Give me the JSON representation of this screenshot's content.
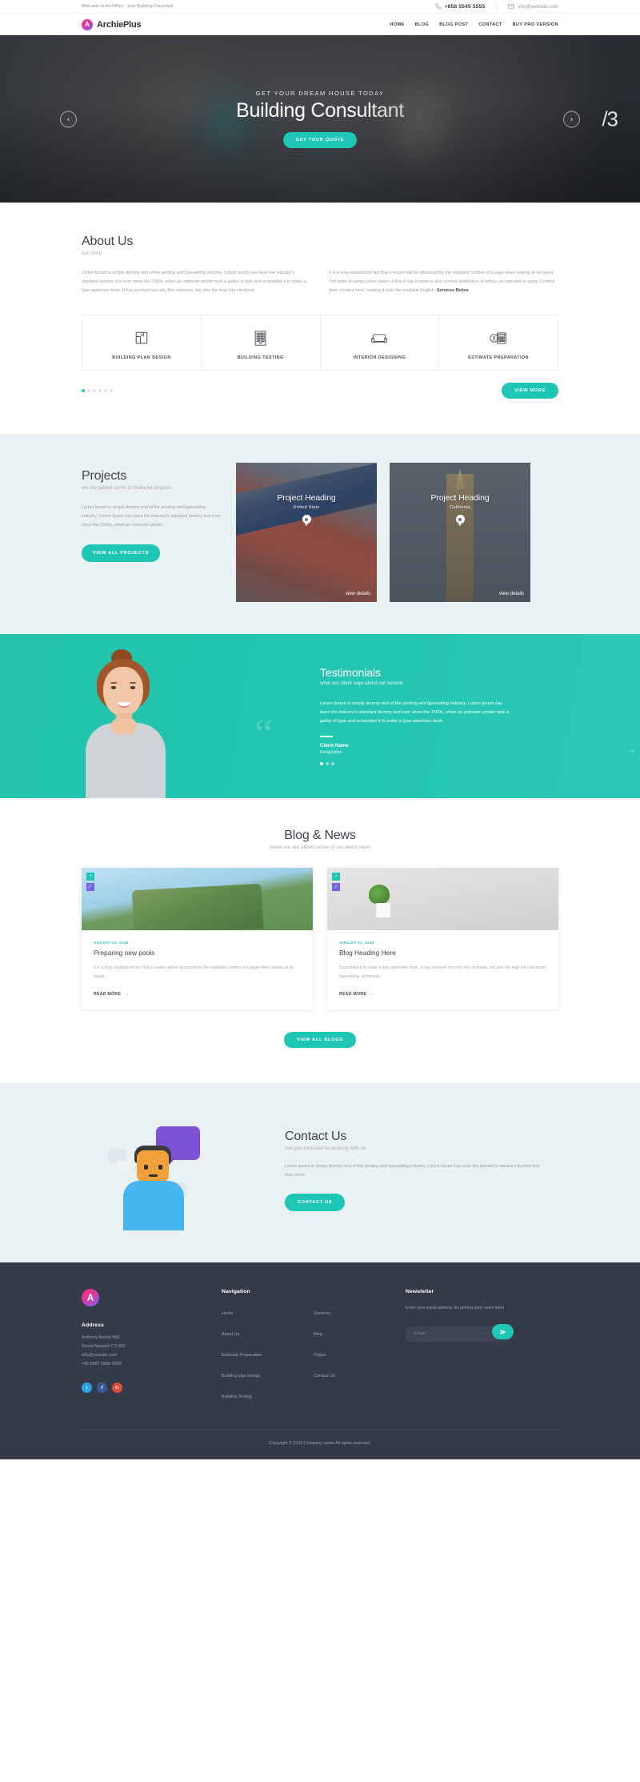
{
  "topbar": {
    "welcome": "Welcome to ArchiPlus - your Building Consulant",
    "phone_icon": "phone-icon",
    "phone": "+856 5545 5555",
    "mail_icon": "envelope-icon",
    "email": "info@website.com"
  },
  "nav": {
    "logo_letter": "A",
    "brand": "ArchiePlus",
    "items": [
      {
        "label": "HOME"
      },
      {
        "label": "BLOG"
      },
      {
        "label": "BLOG POST"
      },
      {
        "label": "CONTACT"
      },
      {
        "label": "BUY PRO VERSION"
      }
    ]
  },
  "hero": {
    "kicker": "GET YOUR DREAM HOUSE TODAY",
    "title": "Building Consultant",
    "cta": "GET YOUR QUOTE",
    "prev_icon": "chevron-left-icon",
    "next_icon": "chevron-right-icon",
    "prev_glyph": "‹",
    "next_glyph": "›",
    "slide_counter": "/3"
  },
  "about": {
    "title": "About Us",
    "subtitle": "our story",
    "left_text": "Lorem Ipsum is simply dummy text of the printing and typesetting industry. Lorem Ipsum has been the industry's standard dummy text ever since the 1500s, when an unknown printer took a galley of type and scrambled it to make a type specimen book. It has survived not only five centuries, but also the leap into electronic",
    "right_text": "It is a long established fact that a reader will be distracted by the readable content of a page when looking at its layout. The point of using Lorem Ipsum is that it has a more-or-less normal distribution of letters, as opposed to using 'Content here, content here', making it look like readable English. ",
    "right_text_bold": "Services Below",
    "services": [
      {
        "label": "BUILDING PLAN DESIGN",
        "icon": "floorplan-icon"
      },
      {
        "label": "BUILDING TESTING",
        "icon": "building-icon"
      },
      {
        "label": "INTERIOR DESIGNING",
        "icon": "sofa-icon"
      },
      {
        "label": "ESTIMATE PREPARATION",
        "icon": "calculator-money-icon"
      }
    ],
    "dots_total": 6,
    "dots_active": 1,
    "view_more": "VIEW MORE"
  },
  "projects": {
    "title": "Projects",
    "subtitle": "we are added some of featured projects",
    "text": "Lorem Ipsum is simply dummy text of the printing and typesetting industry. Lorem Ipsum has been the industry's standard dummy text ever since the 1500s, when an unknown printer...",
    "cta": "VIEW ALL PROJECTS",
    "cards": [
      {
        "heading": "Project Heading",
        "place": "United State",
        "view": "view details",
        "pin_icon": "map-pin-icon"
      },
      {
        "heading": "Project Heading",
        "place": "California",
        "view": "view details",
        "pin_icon": "map-pin-icon"
      }
    ]
  },
  "testimonials": {
    "title": "Testimonials",
    "subtitle": "what our client says about out service",
    "quote_icon": "quote-mark-icon",
    "text": "Lorem Ipsum is simply dummy text of the printing and typesetting industry. Lorem Ipsum has been the industry's standard dummy text ever since the 1500s, when an unknown printer took a galley of type and scrambled it to make a type specimen book.",
    "client_name": "Client Name",
    "designation": "Designation",
    "dots_total": 3,
    "dots_active": 1,
    "end_quote": "”"
  },
  "blog": {
    "title": "Blog & News",
    "subtitle": "below we are added some of our latest news",
    "view_all": "VIEW ALL BLOGS",
    "posts": [
      {
        "date": "AUGUST 22, 2018",
        "heading": "Preparing new pools",
        "excerpt": "It is a long established fact that a reader will be distracted by the readable content of a page when looking at its layout...",
        "read_more": "READ MORE",
        "arrow": "→",
        "action_top_icon": "share-icon",
        "action_bottom_icon": "link-icon"
      },
      {
        "date": "AUGUST 22, 2018",
        "heading": "Blog Heading Here",
        "excerpt": "Scrambled it to make a type specimen book. It has survived not only five centuries, but also the leap into electronic typesetting, remaining...",
        "read_more": "READ MORE",
        "arrow": "→",
        "action_top_icon": "share-icon",
        "action_bottom_icon": "link-icon"
      }
    ]
  },
  "contact": {
    "title": "Contact Us",
    "subtitle": "Are you intrested to working with us",
    "text": "Lorem Ipsum is simply dummy text of the printing and typesetting industry. Lorem Ipsum has been the industry's standard dummy text ever since.",
    "cta": "CONTACT US",
    "illustration_icon": "person-chat-illustration"
  },
  "footer": {
    "logo_letter": "A",
    "address_title": "Address",
    "address_lines": [
      "Anthony Benoit 490,",
      "Street Norwich CT 063",
      "info@website.com",
      "+66 8887 6899 0009"
    ],
    "social": [
      {
        "name": "twitter-icon",
        "glyph": "t"
      },
      {
        "name": "facebook-icon",
        "glyph": "f"
      },
      {
        "name": "google-plus-icon",
        "glyph": "G"
      }
    ],
    "nav_title": "Navigation",
    "nav_col1": [
      {
        "label": "Home"
      },
      {
        "label": "About Us"
      },
      {
        "label": "Estimate Preparation"
      },
      {
        "label": "Building plan design"
      },
      {
        "label": "Building Testing"
      }
    ],
    "nav_col2": [
      {
        "label": "Services"
      },
      {
        "label": "Blog"
      },
      {
        "label": "Pages"
      },
      {
        "label": "Contact Us"
      }
    ],
    "newsletter_title": "Newsletter",
    "newsletter_copy": "Enter your email address for getting daily news letter",
    "newsletter_placeholder": "Email",
    "newsletter_value": "",
    "send_icon": "paper-plane-icon",
    "copyright": "Copyright © 2019 Company name All rights reserved."
  },
  "colors": {
    "accent": "#1ec6b6",
    "teal_section": "#23c3ac",
    "dark": "#343a47",
    "light_section": "#eaf1f3"
  }
}
